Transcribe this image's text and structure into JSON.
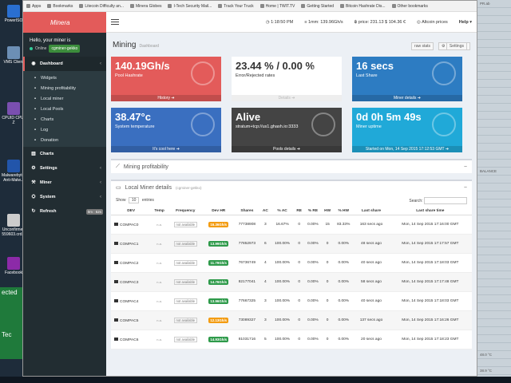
{
  "desktop": {
    "icons": [
      {
        "label": "PowerISO",
        "color": "#2a6fd0"
      },
      {
        "label": "VMS Client",
        "color": "#6c8fb5"
      },
      {
        "label": "CPUID CPU-Z",
        "color": "#7a4fb0"
      },
      {
        "label": "Malwarebytes Anti-Malw...",
        "color": "#2255aa"
      },
      {
        "label": "Unconfirmed 559603.crd...",
        "color": "#cccccc"
      },
      {
        "label": "Facebook",
        "color": "#8c2aa8"
      }
    ],
    "green_panel_text": "ected",
    "green_panel_sub": "Tec"
  },
  "bookmarks": [
    "Apps",
    "Bookmarks",
    "Litecoin Difficulty an...",
    "Minera Globes",
    "I-Tech Security Mail...",
    "Track Your Truck",
    "Home | TWIT.TV",
    "Getting Started",
    "Bitcoin Hashrate Dis...",
    "Other bookmarks"
  ],
  "sidebar": {
    "brand": "Minera",
    "greeting": "Hello, your miner is",
    "status": "Online",
    "miner_name": "cgminer-gekko",
    "items": [
      {
        "label": "Dashboard",
        "icon": "◉",
        "active": true
      },
      {
        "label": "Charts",
        "icon": "▥"
      },
      {
        "label": "Settings",
        "icon": "⚙"
      },
      {
        "label": "Miner",
        "icon": "⚒"
      },
      {
        "label": "System",
        "icon": "⛭"
      },
      {
        "label": "Refresh",
        "icon": "↻",
        "badge": "0m : 52s"
      }
    ],
    "sub_items": [
      "Widgets",
      "Mining profitability",
      "Local miner",
      "Local Pools",
      "Charts",
      "Log",
      "Donation"
    ]
  },
  "topbar": {
    "time": "1:18:50 PM",
    "btc": "1mm: 139.96Gh/s",
    "price": "price: 231.13 $ 104.36 €",
    "altcoin": "Altcoin prices",
    "help": "Help"
  },
  "page": {
    "title": "Mining",
    "subtitle": "Dashboard",
    "btn_raw": "raw stats",
    "btn_settings": "Settings"
  },
  "boxes": [
    {
      "value": "140.19Gh/s",
      "label": "Pool Hashrate",
      "foot": "History",
      "style": "bg-red"
    },
    {
      "value": "23.44 % / 0.00 %",
      "label": "Error/Rejected rates",
      "foot": "Details",
      "style": "bg-white"
    },
    {
      "value": "16 secs",
      "label": "Last Share",
      "foot": "Miner details",
      "style": "bg-blue"
    },
    {
      "value": "38.47°c",
      "label": "System temperature",
      "foot": "It's cool here",
      "style": "bg-temp"
    },
    {
      "value": "Alive",
      "label": "stratum+tcp://us1.ghash.io:3333",
      "foot": "Pools details",
      "style": "bg-dark"
    },
    {
      "value": "0d 0h 5m 49s",
      "label": "Miner uptime",
      "foot": "Started on Mon, 14 Sep 2015 17:12:53 GMT",
      "style": "bg-cyan"
    }
  ],
  "panels": {
    "profitability_title": "Mining profitability",
    "local_title": "Local Miner details",
    "local_sub": "(cgminer-gekko)"
  },
  "table_tools": {
    "show_label": "Show",
    "show_value": "10",
    "entries_label": "entries",
    "search_label": "Search:"
  },
  "table": {
    "headers": [
      "DEV",
      "Temp",
      "Frequency",
      "Dev HR",
      "Shares",
      "AC",
      "% AC",
      "RE",
      "% RE",
      "HW",
      "% HW",
      "Last share",
      "Last share time"
    ],
    "rows": [
      {
        "dev": "COMPAC0",
        "temp": "n.a.",
        "freq": "not available",
        "hr": "16.36Gh/s",
        "hr_color": "hr-orange",
        "shares": "77738908",
        "ac": "3",
        "pac": "16.67%",
        "re": "0",
        "pre": "0.00%",
        "hw": "15",
        "phw": "83.33%",
        "last": "163 secs ago",
        "time": "Mon, 14 Sep 2015 17:16:00 GMT"
      },
      {
        "dev": "COMPAC1",
        "temp": "n.a.",
        "freq": "not available",
        "hr": "13.99Gh/s",
        "hr_color": "hr-green",
        "shares": "77852973",
        "ac": "6",
        "pac": "100.00%",
        "re": "0",
        "pre": "0.00%",
        "hw": "0",
        "phw": "0.00%",
        "last": "48 secs ago",
        "time": "Mon, 14 Sep 2015 17:17:57 GMT"
      },
      {
        "dev": "COMPAC2",
        "temp": "n.a.",
        "freq": "not available",
        "hr": "11.79Gh/s",
        "hr_color": "hr-green",
        "shares": "76736749",
        "ac": "4",
        "pac": "100.00%",
        "re": "0",
        "pre": "0.00%",
        "hw": "0",
        "phw": "0.00%",
        "last": "40 secs ago",
        "time": "Mon, 14 Sep 2015 17:18:03 GMT"
      },
      {
        "dev": "COMPAC3",
        "temp": "n.a.",
        "freq": "not available",
        "hr": "14.76Gh/s",
        "hr_color": "hr-green",
        "shares": "82177041",
        "ac": "4",
        "pac": "100.00%",
        "re": "0",
        "pre": "0.00%",
        "hw": "0",
        "phw": "0.00%",
        "last": "58 secs ago",
        "time": "Mon, 14 Sep 2015 17:17:48 GMT"
      },
      {
        "dev": "COMPAC4",
        "temp": "n.a.",
        "freq": "not available",
        "hr": "13.96Gh/s",
        "hr_color": "hr-green",
        "shares": "77667325",
        "ac": "3",
        "pac": "100.00%",
        "re": "0",
        "pre": "0.00%",
        "hw": "0",
        "phw": "0.00%",
        "last": "40 secs ago",
        "time": "Mon, 14 Sep 2015 17:18:03 GMT"
      },
      {
        "dev": "COMPAC5",
        "temp": "n.a.",
        "freq": "not available",
        "hr": "12.13Gh/s",
        "hr_color": "hr-orange",
        "shares": "73089327",
        "ac": "3",
        "pac": "100.00%",
        "re": "0",
        "pre": "0.00%",
        "hw": "0",
        "phw": "0.00%",
        "last": "137 secs ago",
        "time": "Mon, 14 Sep 2015 17:16:26 GMT"
      },
      {
        "dev": "COMPAC6",
        "temp": "n.a.",
        "freq": "not available",
        "hr": "14.93Gh/s",
        "hr_color": "hr-green",
        "shares": "81031716",
        "ac": "5",
        "pac": "100.00%",
        "re": "0",
        "pre": "0.00%",
        "hw": "0",
        "phw": "0.00%",
        "last": "20 secs ago",
        "time": "Mon, 14 Sep 2015 17:18:23 GMT"
      }
    ]
  },
  "right_strip": [
    "PR.ab",
    "",
    "",
    "",
    "",
    "",
    "",
    "",
    "",
    "",
    "",
    "",
    "",
    "",
    "",
    "",
    "",
    "",
    "",
    "",
    "",
    "BALANCE",
    "",
    "",
    "",
    "",
    "",
    "",
    "",
    "",
    "",
    "",
    "",
    "",
    "",
    "",
    "",
    "",
    "",
    "",
    "",
    "",
    "",
    "",
    "48.0 °C",
    "",
    "38.9 °C"
  ]
}
